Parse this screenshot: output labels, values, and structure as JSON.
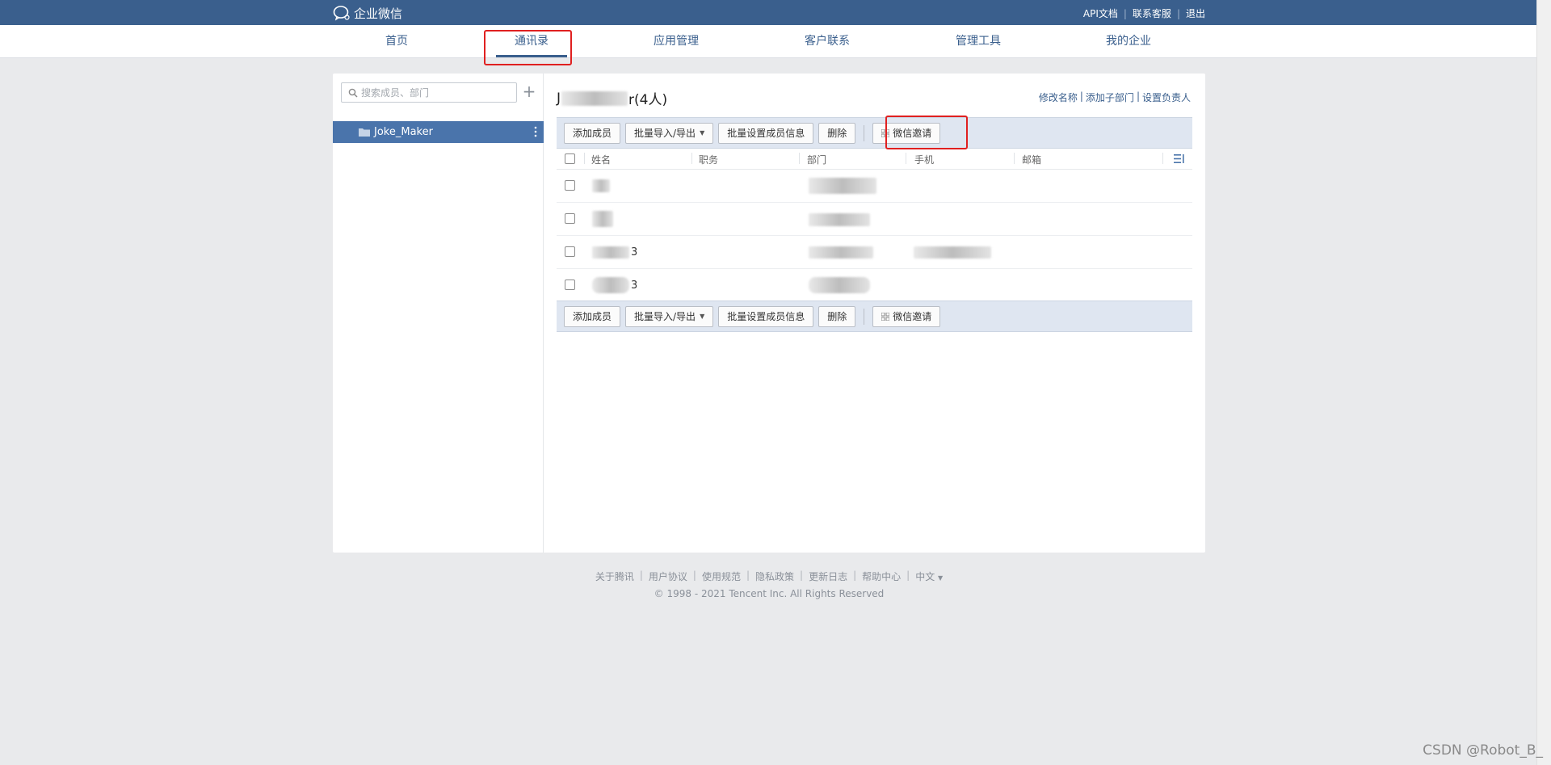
{
  "topbar": {
    "logo_text": "企业微信",
    "links": [
      "API文档",
      "联系客服",
      "退出"
    ]
  },
  "nav": {
    "items": [
      "首页",
      "通讯录",
      "应用管理",
      "客户联系",
      "管理工具",
      "我的企业"
    ],
    "active": "通讯录"
  },
  "sidebar": {
    "search_placeholder": "搜索成员、部门",
    "add_icon": "plus-icon",
    "tree": [
      {
        "label": "Joke_Maker",
        "selected": true
      }
    ]
  },
  "content": {
    "title_prefix": "J",
    "title_suffix": "r(4人)",
    "actions": [
      "修改名称",
      "添加子部门",
      "设置负责人"
    ],
    "toolbar": {
      "add_member": "添加成员",
      "import_export": "批量导入/导出",
      "batch_set": "批量设置成员信息",
      "delete": "删除",
      "wechat_invite": "微信邀请"
    },
    "table": {
      "columns": [
        "姓名",
        "职务",
        "部门",
        "手机",
        "邮箱"
      ],
      "rows": [
        {
          "name_visible": "",
          "dept_blurred": true,
          "phone_blurred": false
        },
        {
          "name_visible": "",
          "dept_blurred": true,
          "phone_blurred": false
        },
        {
          "name_visible": "3",
          "dept_blurred": true,
          "phone_blurred": true
        },
        {
          "name_visible": "3",
          "dept_blurred": true,
          "phone_blurred": false
        }
      ]
    }
  },
  "footer": {
    "links": [
      "关于腾讯",
      "用户协议",
      "使用规范",
      "隐私政策",
      "更新日志",
      "帮助中心",
      "中文"
    ],
    "copyright": "© 1998 - 2021 Tencent Inc. All Rights Reserved"
  },
  "watermark": "CSDN @Robot_B_",
  "colors": {
    "brand": "#3a5f8d",
    "selected_item": "#4a74ab",
    "toolbar_bg": "#dfe6f1",
    "highlight": "#e02020"
  }
}
